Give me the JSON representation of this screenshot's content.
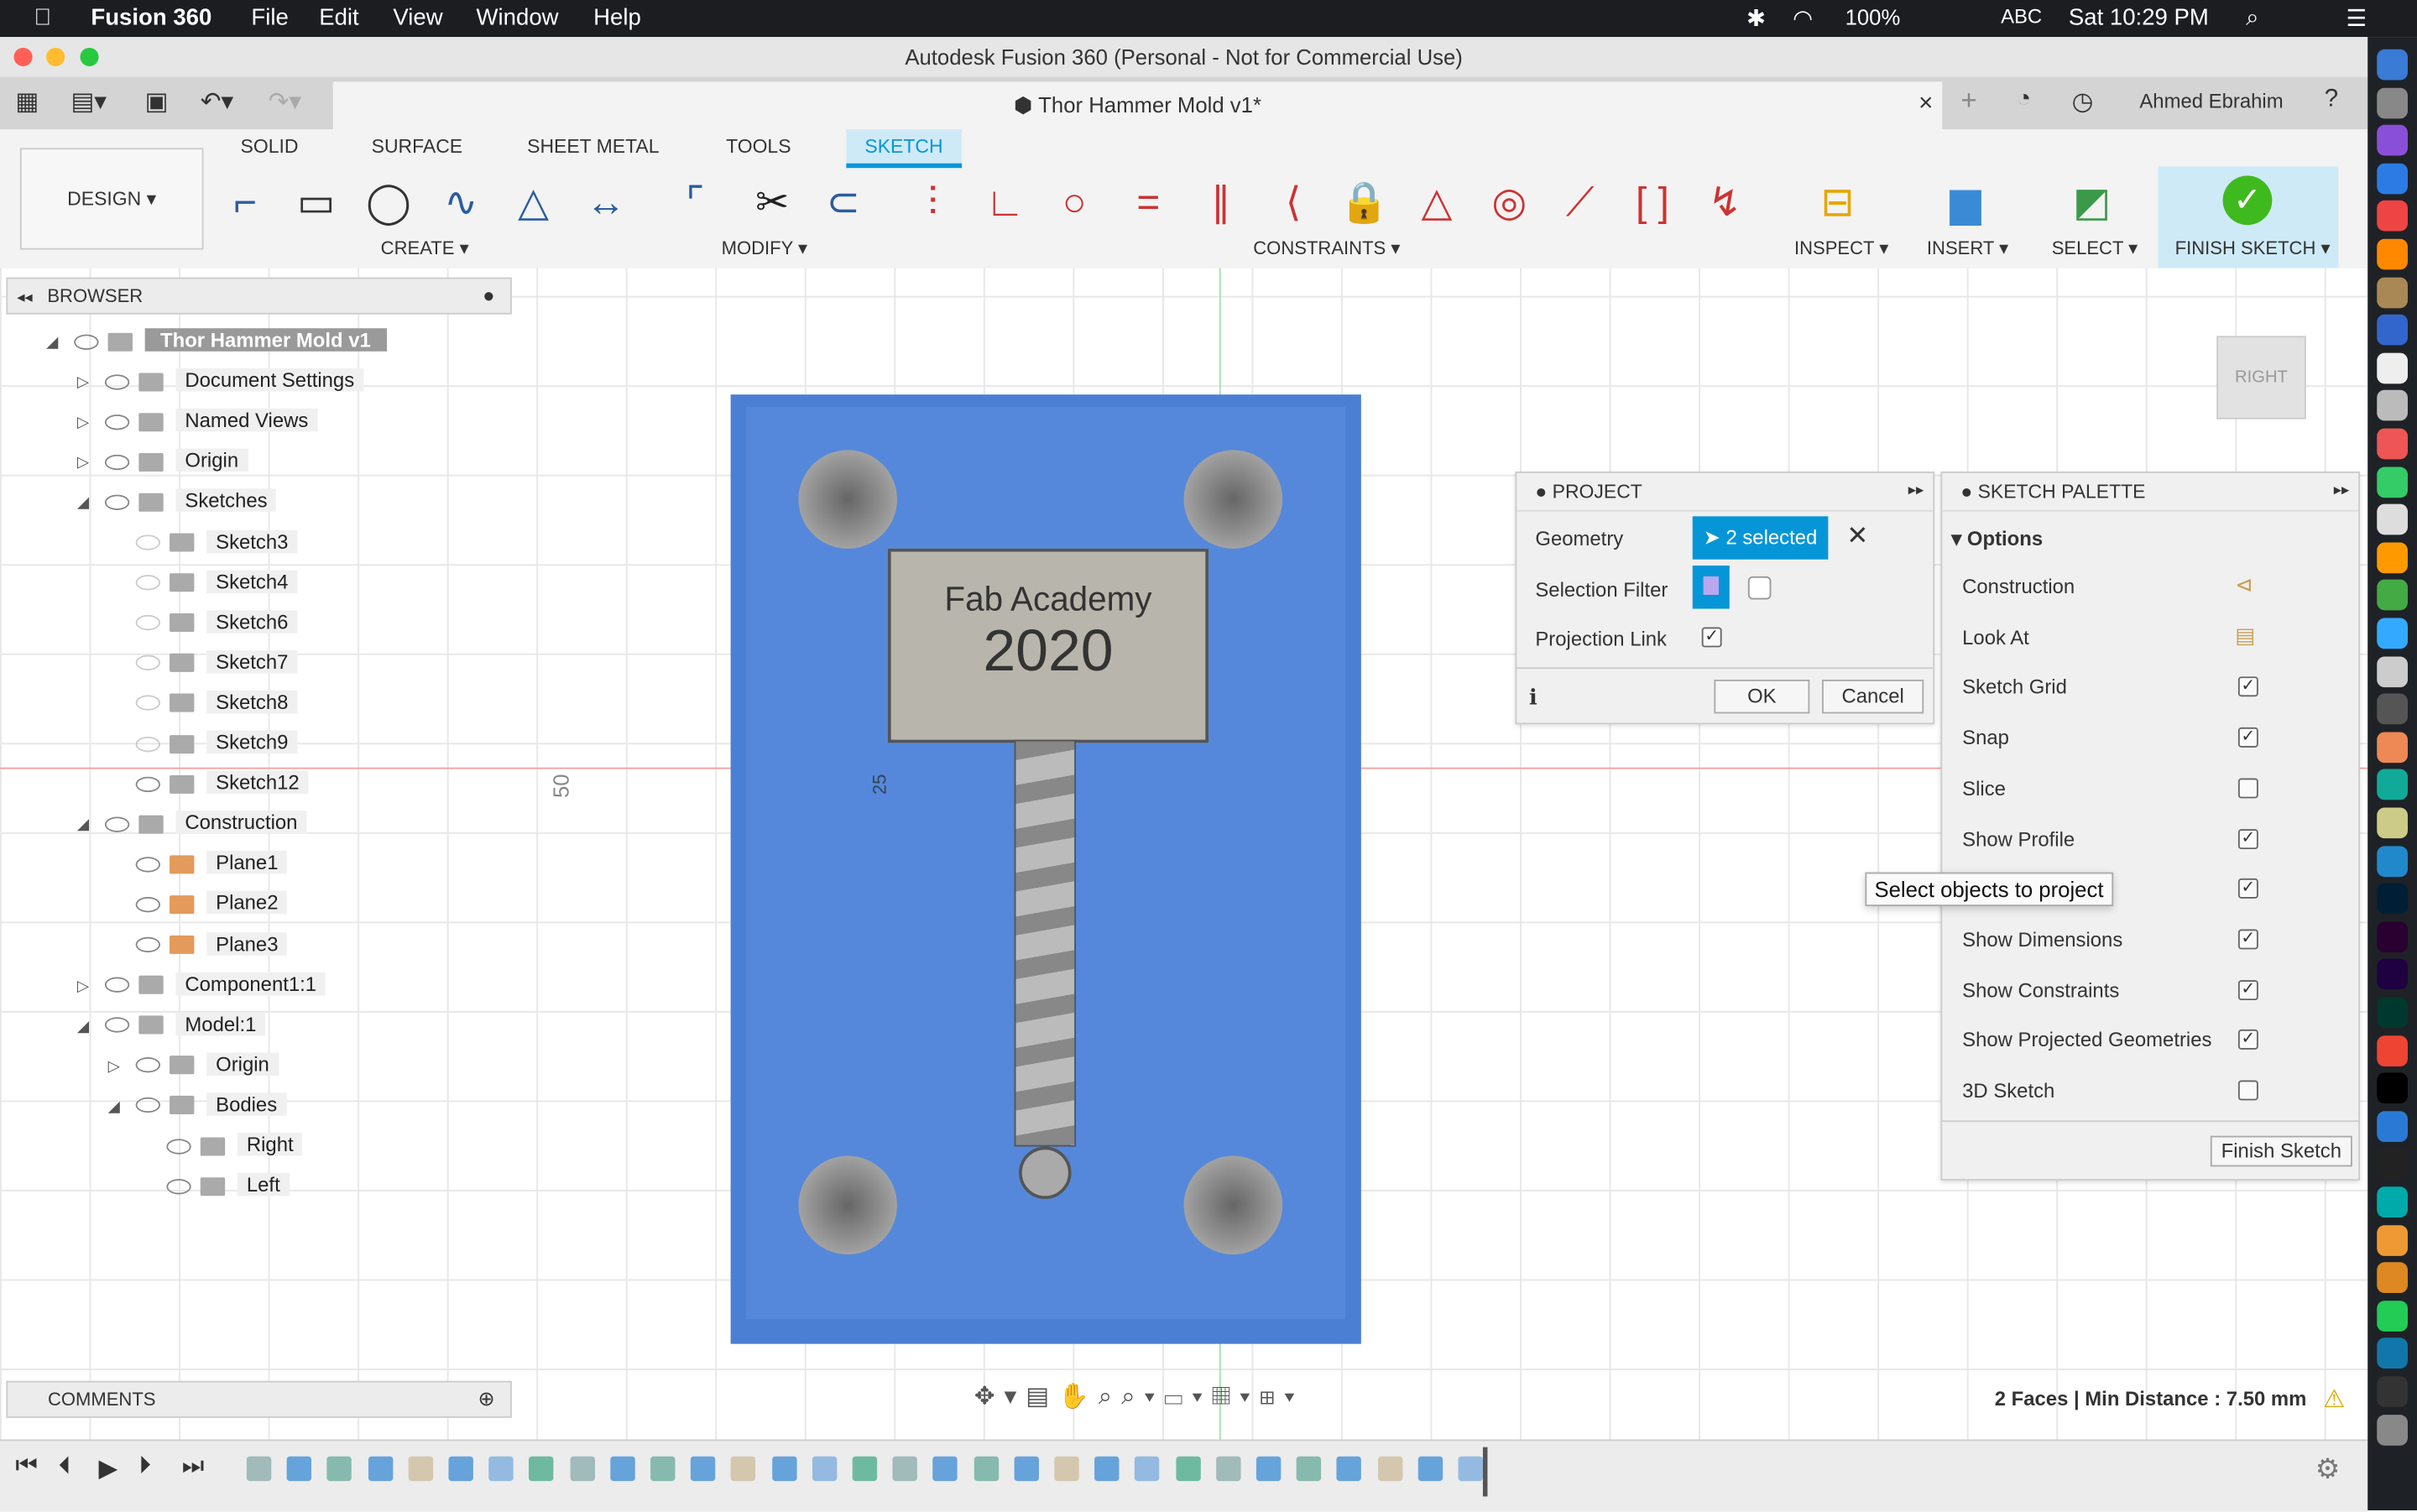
{
  "menubar": {
    "app": "Fusion 360",
    "items": [
      "File",
      "Edit",
      "View",
      "Window",
      "Help"
    ],
    "battery": "100%",
    "input": "ABC",
    "clock": "Sat 10:29 PM"
  },
  "window": {
    "title": "Autodesk Fusion 360 (Personal - Not for Commercial Use)",
    "doc_tab": "Thor Hammer Mold v1*",
    "user": "Ahmed Ebrahim"
  },
  "ribbon": {
    "workspace": "DESIGN",
    "tabs": [
      "SOLID",
      "SURFACE",
      "SHEET METAL",
      "TOOLS",
      "SKETCH"
    ],
    "active_tab": "SKETCH",
    "groups": [
      "CREATE",
      "MODIFY",
      "CONSTRAINTS",
      "INSPECT",
      "INSERT",
      "SELECT",
      "FINISH SKETCH"
    ],
    "accent": "#0696d7"
  },
  "browser": {
    "title": "BROWSER",
    "items": [
      {
        "label": "Thor Hammer Mold v1",
        "level": 0
      },
      {
        "label": "Document Settings",
        "level": 1
      },
      {
        "label": "Named Views",
        "level": 1
      },
      {
        "label": "Origin",
        "level": 1
      },
      {
        "label": "Sketches",
        "level": 1
      },
      {
        "label": "Sketch3",
        "level": 2
      },
      {
        "label": "Sketch4",
        "level": 2
      },
      {
        "label": "Sketch6",
        "level": 2
      },
      {
        "label": "Sketch7",
        "level": 2
      },
      {
        "label": "Sketch8",
        "level": 2
      },
      {
        "label": "Sketch9",
        "level": 2
      },
      {
        "label": "Sketch12",
        "level": 2
      },
      {
        "label": "Construction",
        "level": 1
      },
      {
        "label": "Plane1",
        "level": 2
      },
      {
        "label": "Plane2",
        "level": 2
      },
      {
        "label": "Plane3",
        "level": 2
      },
      {
        "label": "Component1:1",
        "level": 1
      },
      {
        "label": "Model:1",
        "level": 1
      },
      {
        "label": "Origin",
        "level": 2
      },
      {
        "label": "Bodies",
        "level": 2
      },
      {
        "label": "Right",
        "level": 3
      },
      {
        "label": "Left",
        "level": 3
      }
    ]
  },
  "viewport": {
    "model_text_1": "Fab Academy",
    "model_text_2": "2020",
    "dim_50": "50",
    "dim_25": "25",
    "viewcube": "RIGHT",
    "model_color": "#4a7fd4"
  },
  "project": {
    "title": "PROJECT",
    "geometry_label": "Geometry",
    "geometry_value": "2 selected",
    "filter_label": "Selection Filter",
    "link_label": "Projection Link",
    "link_checked": true,
    "ok": "OK",
    "cancel": "Cancel"
  },
  "tooltip": "Select objects to project",
  "palette": {
    "title": "SKETCH PALETTE",
    "section": "Options",
    "rows": [
      {
        "label": "Construction",
        "type": "icon"
      },
      {
        "label": "Look At",
        "type": "icon"
      },
      {
        "label": "Sketch Grid",
        "checked": true
      },
      {
        "label": "Snap",
        "checked": true
      },
      {
        "label": "Slice",
        "checked": false
      },
      {
        "label": "Show Profile",
        "checked": true
      },
      {
        "label": "",
        "checked": true
      },
      {
        "label": "Show Dimensions",
        "checked": true
      },
      {
        "label": "Show Constraints",
        "checked": true
      },
      {
        "label": "Show Projected Geometries",
        "checked": true
      },
      {
        "label": "3D Sketch",
        "checked": false
      }
    ],
    "finish": "Finish Sketch"
  },
  "comments": {
    "title": "COMMENTS"
  },
  "status": "2 Faces | Min Distance : 7.50 mm"
}
